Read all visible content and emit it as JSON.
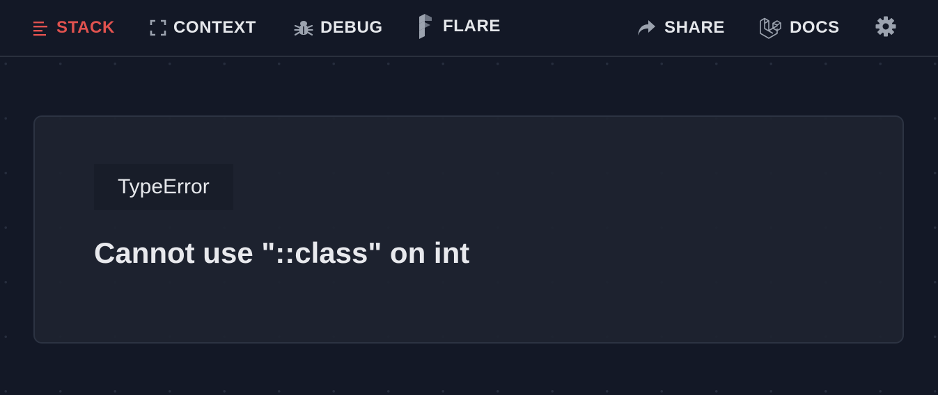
{
  "nav": {
    "stack": {
      "label": "STACK",
      "icon": "list-lines-icon",
      "active": true
    },
    "context": {
      "label": "CONTEXT",
      "icon": "frame-corners-icon"
    },
    "debug": {
      "label": "DEBUG",
      "icon": "bug-icon"
    },
    "flare": {
      "label": "FLARE",
      "icon": "flare-logo-icon"
    },
    "share": {
      "label": "SHARE",
      "icon": "share-arrow-icon"
    },
    "docs": {
      "label": "DOCS",
      "icon": "laravel-logo-icon"
    },
    "settings": {
      "icon": "gear-icon"
    }
  },
  "error": {
    "class_name": "TypeError",
    "message": "Cannot use \"::class\" on int"
  },
  "colors": {
    "background": "#131826",
    "card": "#1e2330",
    "accent": "#e0524f",
    "text": "#e5e7eb",
    "icon_muted": "#9ca3af"
  }
}
